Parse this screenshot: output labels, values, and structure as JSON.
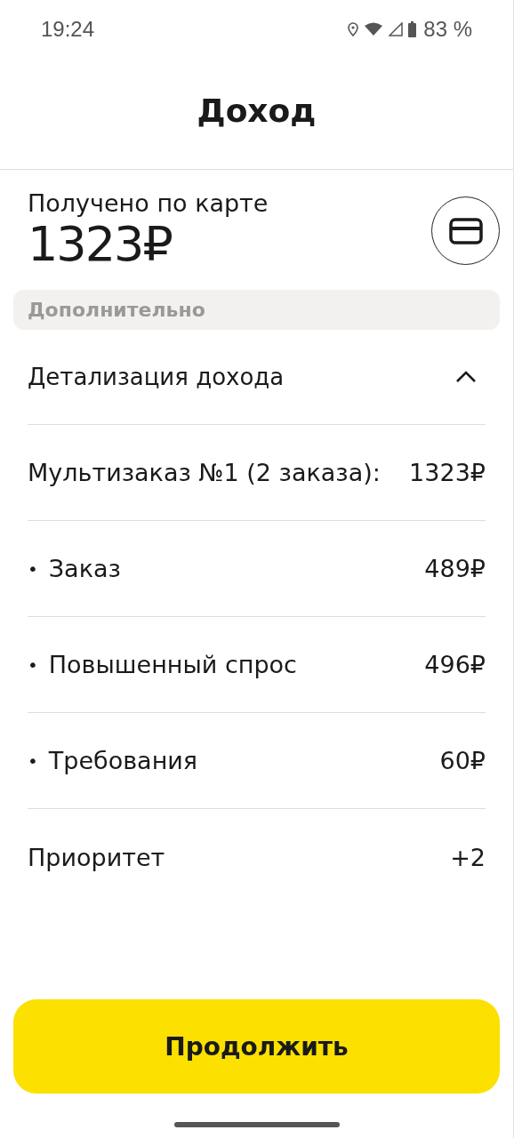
{
  "status_bar": {
    "time": "19:24",
    "battery": "83 %"
  },
  "header": {
    "title": "Доход"
  },
  "summary": {
    "label": "Получено по карте",
    "amount": "1323₽"
  },
  "extra_label": "Дополнительно",
  "details": {
    "title": "Детализация дохода",
    "expanded": true,
    "rows": [
      {
        "kind": "plain",
        "label": "Мультизаказ №1 (2 заказа):",
        "value": "1323₽"
      },
      {
        "kind": "bullet",
        "bullet": "•",
        "label": "Заказ",
        "value": "489₽"
      },
      {
        "kind": "bullet",
        "bullet": "•",
        "label": "Повышенный спрос",
        "value": "496₽"
      },
      {
        "kind": "bullet",
        "bullet": "•",
        "label": "Требования",
        "value": "60₽"
      },
      {
        "kind": "plain",
        "label": "Приоритет",
        "value": "+2"
      }
    ]
  },
  "continue_button": "Продолжить"
}
